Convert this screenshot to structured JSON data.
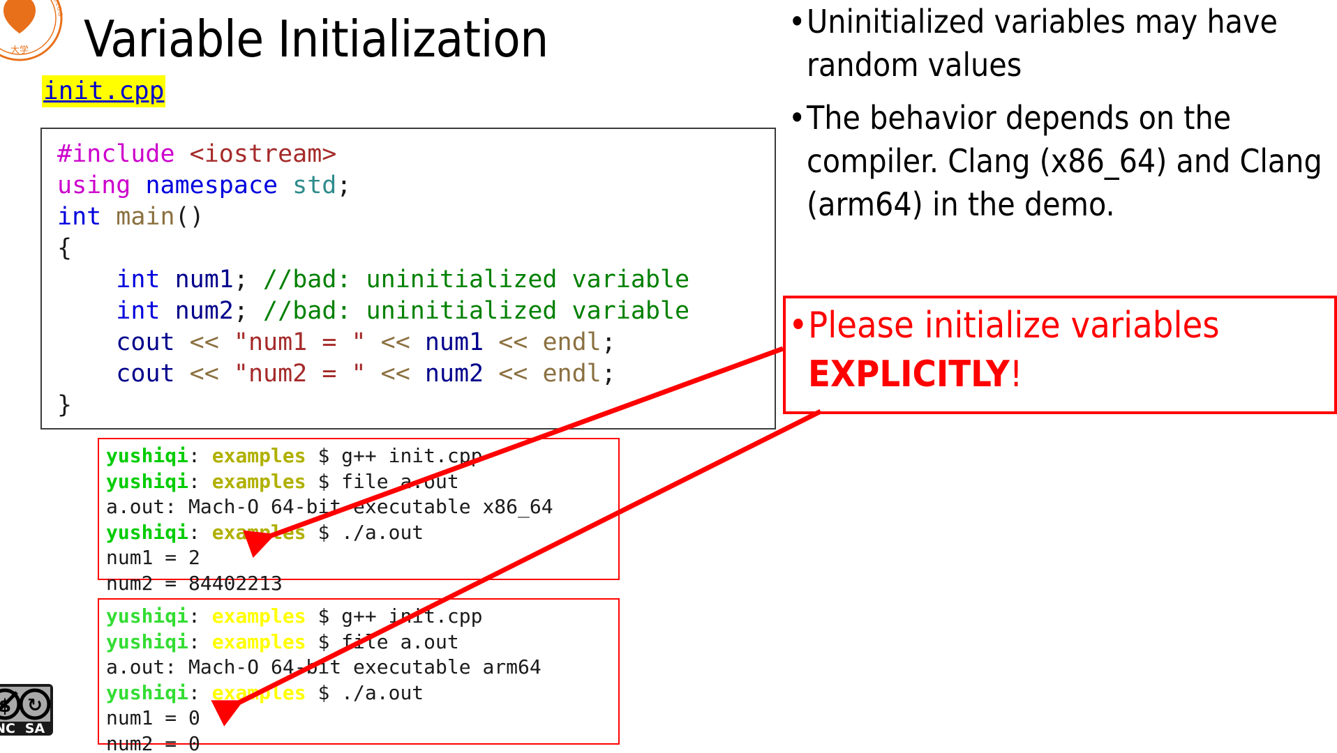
{
  "slide": {
    "title": "Variable Initialization",
    "file_link": "init.cpp",
    "logo": "university-seal-logo",
    "license_badge": "creative-commons-by-nc-sa-badge",
    "license_badge_labels": [
      "NC",
      "SA"
    ]
  },
  "colors": {
    "highlight_bg": "#ffff00",
    "link_text": "#0000cc",
    "warning_red": "#ff0000",
    "comment_green": "#008000",
    "keyword_blue": "#0000dd",
    "preproc_magenta": "#cc00cc",
    "string_maroon": "#a52a2a",
    "operator_tan": "#8b7040",
    "prompt_user_green": "#00cc00",
    "prompt_dir_olive": "#b0b000",
    "prompt_dir_yellow": "#ffff00",
    "logo_orange": "#e8701a"
  },
  "code": {
    "language": "cpp",
    "lines": [
      [
        {
          "t": "#include ",
          "c": "k-pre"
        },
        {
          "t": "<iostream>",
          "c": "k-hdr"
        }
      ],
      [
        {
          "t": "using ",
          "c": "k-pre"
        },
        {
          "t": "namespace ",
          "c": "k-kw"
        },
        {
          "t": "std",
          "c": "k-type"
        },
        {
          "t": ";",
          "c": "k-pl"
        }
      ],
      [
        {
          "t": "int ",
          "c": "k-kw"
        },
        {
          "t": "main",
          "c": "k-fn"
        },
        {
          "t": "()",
          "c": "k-pl"
        }
      ],
      [
        {
          "t": "{",
          "c": "k-pl"
        }
      ],
      [
        {
          "t": "    ",
          "c": "k-pl"
        },
        {
          "t": "int ",
          "c": "k-kw"
        },
        {
          "t": "num1",
          "c": "k-id"
        },
        {
          "t": "; ",
          "c": "k-pl"
        },
        {
          "t": "//bad: uninitialized variable",
          "c": "k-cmt"
        }
      ],
      [
        {
          "t": "    ",
          "c": "k-pl"
        },
        {
          "t": "int ",
          "c": "k-kw"
        },
        {
          "t": "num2",
          "c": "k-id"
        },
        {
          "t": "; ",
          "c": "k-pl"
        },
        {
          "t": "//bad: uninitialized variable",
          "c": "k-cmt"
        }
      ],
      [
        {
          "t": "    ",
          "c": "k-pl"
        },
        {
          "t": "cout",
          "c": "k-id"
        },
        {
          "t": " << ",
          "c": "k-fn"
        },
        {
          "t": "\"num1 = \"",
          "c": "k-str"
        },
        {
          "t": " << ",
          "c": "k-fn"
        },
        {
          "t": "num1",
          "c": "k-id"
        },
        {
          "t": " << ",
          "c": "k-fn"
        },
        {
          "t": "endl",
          "c": "k-fn"
        },
        {
          "t": ";",
          "c": "k-pl"
        }
      ],
      [
        {
          "t": "    ",
          "c": "k-pl"
        },
        {
          "t": "cout",
          "c": "k-id"
        },
        {
          "t": " << ",
          "c": "k-fn"
        },
        {
          "t": "\"num2 = \"",
          "c": "k-str"
        },
        {
          "t": " << ",
          "c": "k-fn"
        },
        {
          "t": "num2",
          "c": "k-id"
        },
        {
          "t": " << ",
          "c": "k-fn"
        },
        {
          "t": "endl",
          "c": "k-fn"
        },
        {
          "t": ";",
          "c": "k-pl"
        }
      ],
      [
        {
          "t": "}",
          "c": "k-pl"
        }
      ]
    ]
  },
  "terminals": [
    {
      "name": "x86_64-terminal",
      "arch": "x86_64",
      "lines": [
        [
          {
            "t": "yushiqi",
            "c": "user1"
          },
          {
            "t": ": ",
            "c": "plain"
          },
          {
            "t": "examples",
            "c": "dir1"
          },
          {
            "t": " $ g++ init.cpp",
            "c": "plain"
          }
        ],
        [
          {
            "t": "yushiqi",
            "c": "user1"
          },
          {
            "t": ": ",
            "c": "plain"
          },
          {
            "t": "examples",
            "c": "dir1"
          },
          {
            "t": " $ file a.out",
            "c": "plain"
          }
        ],
        [
          {
            "t": "a.out: Mach-O 64-bit executable x86_64",
            "c": "plain"
          }
        ],
        [
          {
            "t": "yushiqi",
            "c": "user1"
          },
          {
            "t": ": ",
            "c": "plain"
          },
          {
            "t": "examples",
            "c": "dir1"
          },
          {
            "t": " $ ./a.out",
            "c": "plain"
          }
        ],
        [
          {
            "t": "num1 = 2",
            "c": "plain"
          }
        ],
        [
          {
            "t": "num2 = 84402213",
            "c": "plain"
          }
        ]
      ]
    },
    {
      "name": "arm64-terminal",
      "arch": "arm64",
      "lines": [
        [
          {
            "t": "yushiqi",
            "c": "user2"
          },
          {
            "t": ": ",
            "c": "plain"
          },
          {
            "t": "examples",
            "c": "dir2"
          },
          {
            "t": " $ g++ init.cpp",
            "c": "plain"
          }
        ],
        [
          {
            "t": "yushiqi",
            "c": "user2"
          },
          {
            "t": ": ",
            "c": "plain"
          },
          {
            "t": "examples",
            "c": "dir2"
          },
          {
            "t": " $ file a.out",
            "c": "plain"
          }
        ],
        [
          {
            "t": "a.out: Mach-O 64-bit executable arm64",
            "c": "plain"
          }
        ],
        [
          {
            "t": "yushiqi",
            "c": "user2"
          },
          {
            "t": ": ",
            "c": "plain"
          },
          {
            "t": "examples",
            "c": "dir2"
          },
          {
            "t": " $ ./a.out",
            "c": "plain"
          }
        ],
        [
          {
            "t": "num1 = 0",
            "c": "plain"
          }
        ],
        [
          {
            "t": "num2 = 0",
            "c": "plain"
          }
        ]
      ]
    }
  ],
  "bullets": [
    {
      "marker": "•",
      "text": "Uninitialized variables may have random values"
    },
    {
      "marker": "•",
      "text": "The behavior depends on the compiler. Clang (x86_64) and Clang (arm64) in the demo."
    }
  ],
  "warning": {
    "marker": "•",
    "text_before": "Please initialize variables ",
    "emphasis": "EXPLICITLY",
    "text_after": "!"
  },
  "annotations": {
    "arrow_1_name": "arrow-to-x86-output",
    "arrow_2_name": "arrow-to-arm64-output"
  }
}
